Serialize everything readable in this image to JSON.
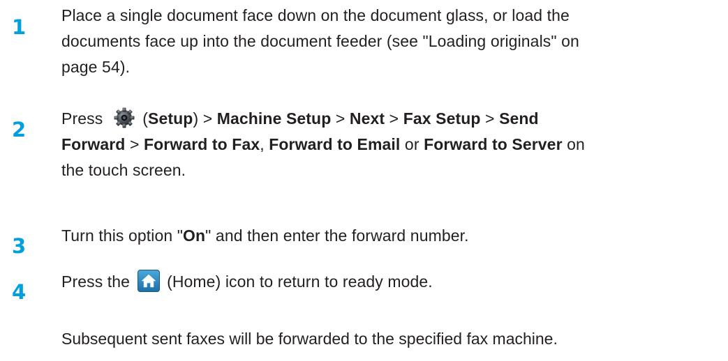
{
  "steps": [
    {
      "number": "1",
      "lines": [
        "Place a single document face down on the document glass, or load the",
        "documents face up into the document feeder (see \"Loading originals\" on",
        "page 54)."
      ]
    },
    {
      "number": "2",
      "press": "Press",
      "icon": "gear-icon",
      "setup": "Setup",
      "sep": ">",
      "machine_setup": "Machine Setup",
      "next": "Next",
      "fax_setup": "Fax Setup",
      "send": "Send",
      "forward": "Forward",
      "forward_to_fax": "Forward to Fax",
      "forward_to_email": "Forward to Email",
      "or": "or",
      "forward_to_server": "Forward to Server",
      "on": "on",
      "tail": "the touch screen."
    },
    {
      "number": "3",
      "pre": "Turn this option \"",
      "on_word": "On",
      "post": "\" and then enter the forward number."
    },
    {
      "number": "4",
      "pre": "Press the",
      "icon": "home-icon",
      "post": "(Home) icon to return to ready mode."
    }
  ],
  "note": "Subsequent sent faxes will be forwarded to the specified fax machine.",
  "colors": {
    "step_number": "#00a0e0",
    "text": "#231f20",
    "home_icon": "#2a86c4"
  }
}
